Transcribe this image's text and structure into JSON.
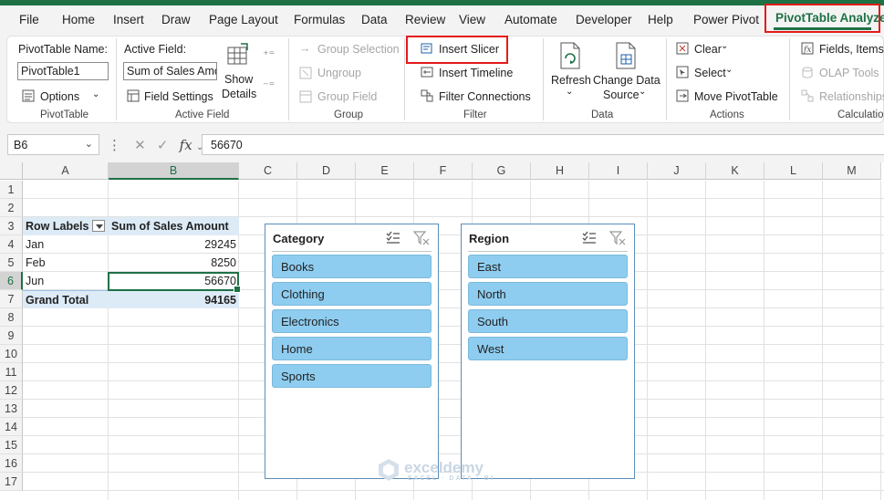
{
  "menu": {
    "tabs": [
      "File",
      "Home",
      "Insert",
      "Draw",
      "Page Layout",
      "Formulas",
      "Data",
      "Review",
      "View",
      "Automate",
      "Developer",
      "Help",
      "Power Pivot"
    ],
    "active_tab": "PivotTable Analyze"
  },
  "ribbon": {
    "pivottable": {
      "name_label": "PivotTable Name:",
      "name_value": "PivotTable1",
      "options_label": "Options",
      "group": "PivotTable"
    },
    "active_field": {
      "label": "Active Field:",
      "value": "Sum of Sales Amount",
      "field_settings": "Field Settings",
      "show_details_1": "Show",
      "show_details_2": "Details",
      "group": "Active Field"
    },
    "group_section": {
      "group_selection": "Group Selection",
      "ungroup": "Ungroup",
      "group_field": "Group Field",
      "group": "Group"
    },
    "filter": {
      "insert_slicer": "Insert Slicer",
      "insert_timeline": "Insert Timeline",
      "filter_connections": "Filter Connections",
      "group": "Filter"
    },
    "data": {
      "refresh": "Refresh",
      "change_source_1": "Change Data",
      "change_source_2": "Source",
      "group": "Data"
    },
    "actions": {
      "clear": "Clear",
      "select": "Select",
      "move": "Move PivotTable",
      "group": "Actions"
    },
    "calculations": {
      "fields_items": "Fields, Items,",
      "olap_tools": "OLAP Tools",
      "relationships": "Relationships",
      "group": "Calculatio"
    }
  },
  "formula_bar": {
    "name_box": "B6",
    "fx": "fx",
    "value": "56670"
  },
  "columns": [
    "A",
    "B",
    "C",
    "D",
    "E",
    "F",
    "G",
    "H",
    "I",
    "J",
    "K",
    "L",
    "M"
  ],
  "rows": [
    "1",
    "2",
    "3",
    "4",
    "5",
    "6",
    "7",
    "8",
    "9",
    "10",
    "11",
    "12",
    "13",
    "14",
    "15",
    "16",
    "17"
  ],
  "pivot": {
    "header_labels": "Row Labels",
    "header_sum": "Sum of Sales Amount",
    "rows": [
      {
        "label": "Jan",
        "value": "29245"
      },
      {
        "label": "Feb",
        "value": "8250"
      },
      {
        "label": "Jun",
        "value": "56670"
      }
    ],
    "total_label": "Grand Total",
    "total_value": "94165"
  },
  "slicers": [
    {
      "title": "Category",
      "items": [
        "Books",
        "Clothing",
        "Electronics",
        "Home",
        "Sports"
      ]
    },
    {
      "title": "Region",
      "items": [
        "East",
        "North",
        "South",
        "West"
      ]
    }
  ],
  "watermark": {
    "name": "exceldemy",
    "tagline": "EXCEL · DATA · BI"
  },
  "colors": {
    "excel_green": "#1e7145",
    "highlight_red": "#e31b1b",
    "slicer_item": "#8ecdf0",
    "pivot_header": "#ddebf7"
  }
}
